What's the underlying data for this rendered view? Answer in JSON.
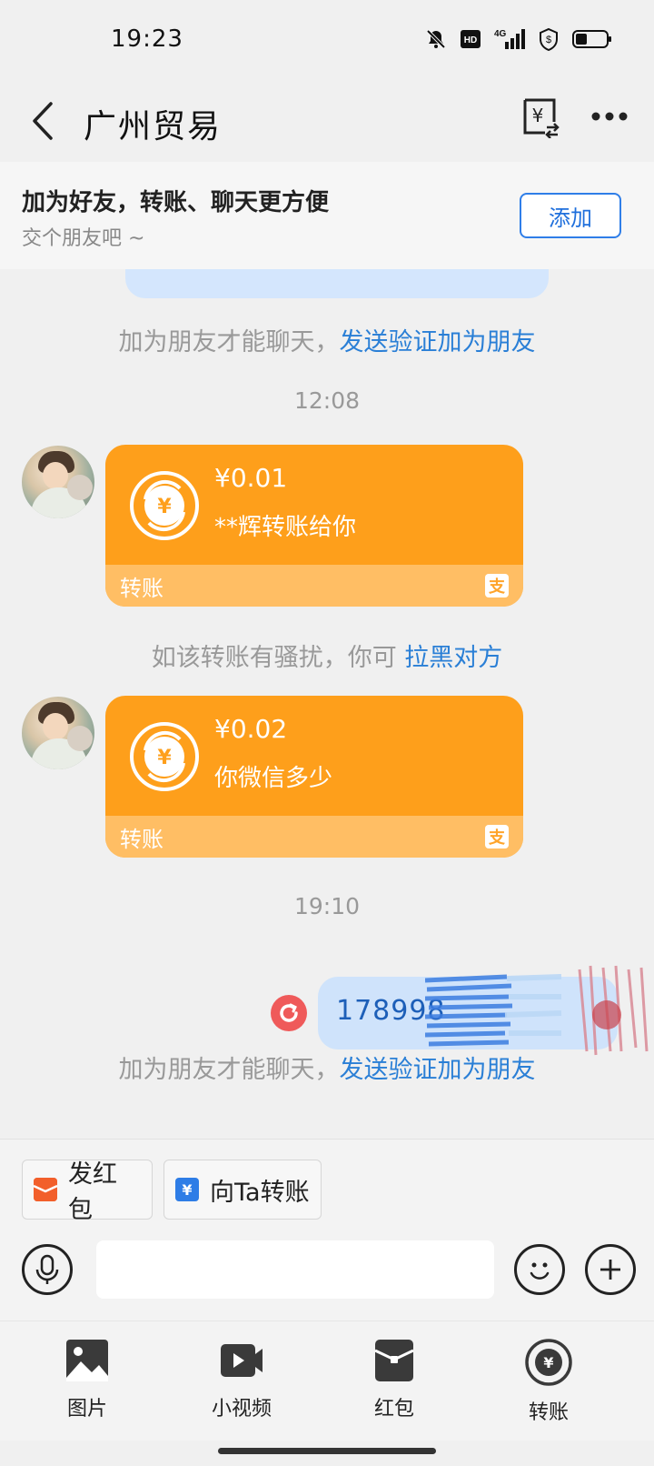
{
  "status_bar": {
    "time": "19:23",
    "icons": [
      "bell-off-icon",
      "hd-icon",
      "4g-signal-icon",
      "shield-icon",
      "battery-icon"
    ],
    "network": "4G",
    "hd": "HD"
  },
  "header": {
    "title": "广州贸易",
    "back_icon": "back-arrow-icon",
    "transfer_icon": "yuan-transfer-icon",
    "more_icon": "more-dots-icon"
  },
  "banner": {
    "title": "加为好友，转账、聊天更方便",
    "subtitle": "交个朋友吧 ~",
    "add_button": "添加"
  },
  "chat": {
    "system_notice_1": {
      "text": "加为朋友才能聊天，",
      "link": "发送验证加为朋友"
    },
    "time_1": "12:08",
    "transfer_1": {
      "amount": "¥0.01",
      "note": "**辉转账给你",
      "footer": "转账"
    },
    "harass_notice": {
      "text": "如该转账有骚扰，你可 ",
      "link": "拉黑对方"
    },
    "transfer_2": {
      "amount": "¥0.02",
      "note": "你微信多少",
      "footer": "转账"
    },
    "time_2": "19:10",
    "my_message": "178998",
    "system_notice_2": {
      "text": "加为朋友才能聊天，",
      "link": "发送验证加为朋友"
    }
  },
  "quick_actions": {
    "red_packet": "发红包",
    "transfer": "向Ta转账"
  },
  "input": {
    "placeholder": ""
  },
  "tools": [
    {
      "label": "图片",
      "icon": "image-icon"
    },
    {
      "label": "小视频",
      "icon": "video-icon"
    },
    {
      "label": "红包",
      "icon": "red-packet-icon"
    },
    {
      "label": "转账",
      "icon": "transfer-icon"
    }
  ],
  "colors": {
    "transfer_card": "#fe9f1b",
    "transfer_footer": "#ffbe64",
    "link": "#2a7fd6",
    "my_bubble": "#cfe3fb",
    "retry": "#ef5a5a"
  }
}
